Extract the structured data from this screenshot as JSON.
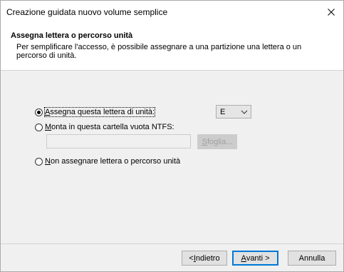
{
  "window": {
    "title": "Creazione guidata nuovo volume semplice"
  },
  "header": {
    "title": "Assegna lettera o percorso unità",
    "description": "Per semplificare l'accesso, è possibile assegnare a una partizione una lettera o un percorso di unità."
  },
  "options": {
    "assign_letter": {
      "label_pre": "",
      "label_hotkey": "A",
      "label_post": "ssegna questa lettera di unità:",
      "checked": true
    },
    "mount_folder": {
      "label_pre": "",
      "label_hotkey": "M",
      "label_post": "onta in questa cartella vuota NTFS:",
      "checked": false
    },
    "no_letter": {
      "label_pre": "",
      "label_hotkey": "N",
      "label_post": "on assegnare lettera o percorso unità",
      "checked": false
    }
  },
  "drive_letter": {
    "selected": "E"
  },
  "folder_path": {
    "value": ""
  },
  "buttons": {
    "browse": {
      "pre": "",
      "hotkey": "S",
      "post": "foglia..."
    },
    "back": {
      "pre": "< ",
      "hotkey": "I",
      "post": "ndietro"
    },
    "next": {
      "pre": "",
      "hotkey": "A",
      "post": "vanti >"
    },
    "cancel": {
      "label": "Annulla"
    }
  },
  "icons": {
    "close": "close-icon",
    "dropdown": "chevron-down-icon"
  },
  "colors": {
    "accent": "#0078d7",
    "window_bg": "#f0f0f0",
    "header_bg": "#ffffff"
  }
}
